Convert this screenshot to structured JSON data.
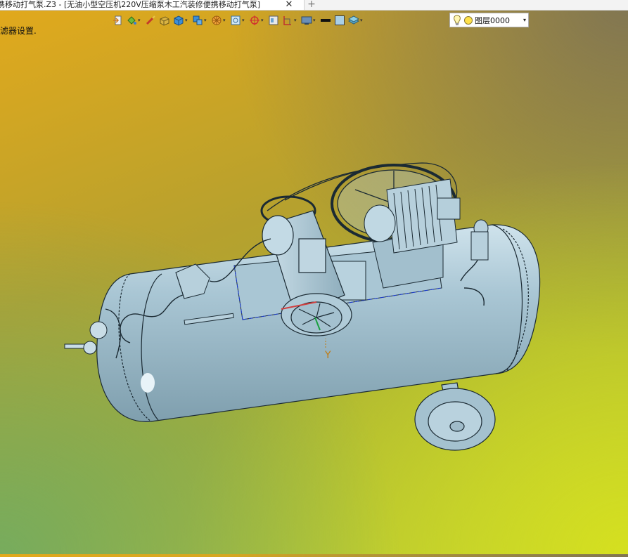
{
  "window": {
    "tab_title": "携移动打气泵.Z3 - [无油小型空压机220V压缩泵木工汽装修便携移动打气泵]",
    "close_glyph": "✕",
    "add_glyph": "+"
  },
  "toolbar": {
    "buttons": [
      {
        "icon": "exit-icon",
        "dropdown": false
      },
      {
        "icon": "paint-bucket-icon",
        "dropdown": true
      },
      {
        "icon": "brush-icon",
        "dropdown": false
      },
      {
        "icon": "block-icon",
        "dropdown": false
      },
      {
        "icon": "cube-icon",
        "dropdown": true
      },
      {
        "icon": "cubes-icon",
        "dropdown": true
      },
      {
        "icon": "wheel-icon",
        "dropdown": true
      },
      {
        "icon": "view-frame-icon",
        "dropdown": true
      },
      {
        "icon": "target-icon",
        "dropdown": true
      },
      {
        "icon": "panel-icon",
        "dropdown": false
      },
      {
        "icon": "section-icon",
        "dropdown": true
      },
      {
        "icon": "monitor-icon",
        "dropdown": true
      },
      {
        "icon": "line-weight-icon",
        "dropdown": false
      },
      {
        "icon": "color-swatch-icon",
        "dropdown": false
      },
      {
        "icon": "layers-icon",
        "dropdown": true
      }
    ],
    "dropdown_glyph": "▾"
  },
  "layer": {
    "value": "图层0000",
    "arrow": "▾"
  },
  "status": {
    "message": "滤器设置."
  },
  "viewport": {
    "axis_label": "Y",
    "model_color": "#a9c6d4"
  }
}
